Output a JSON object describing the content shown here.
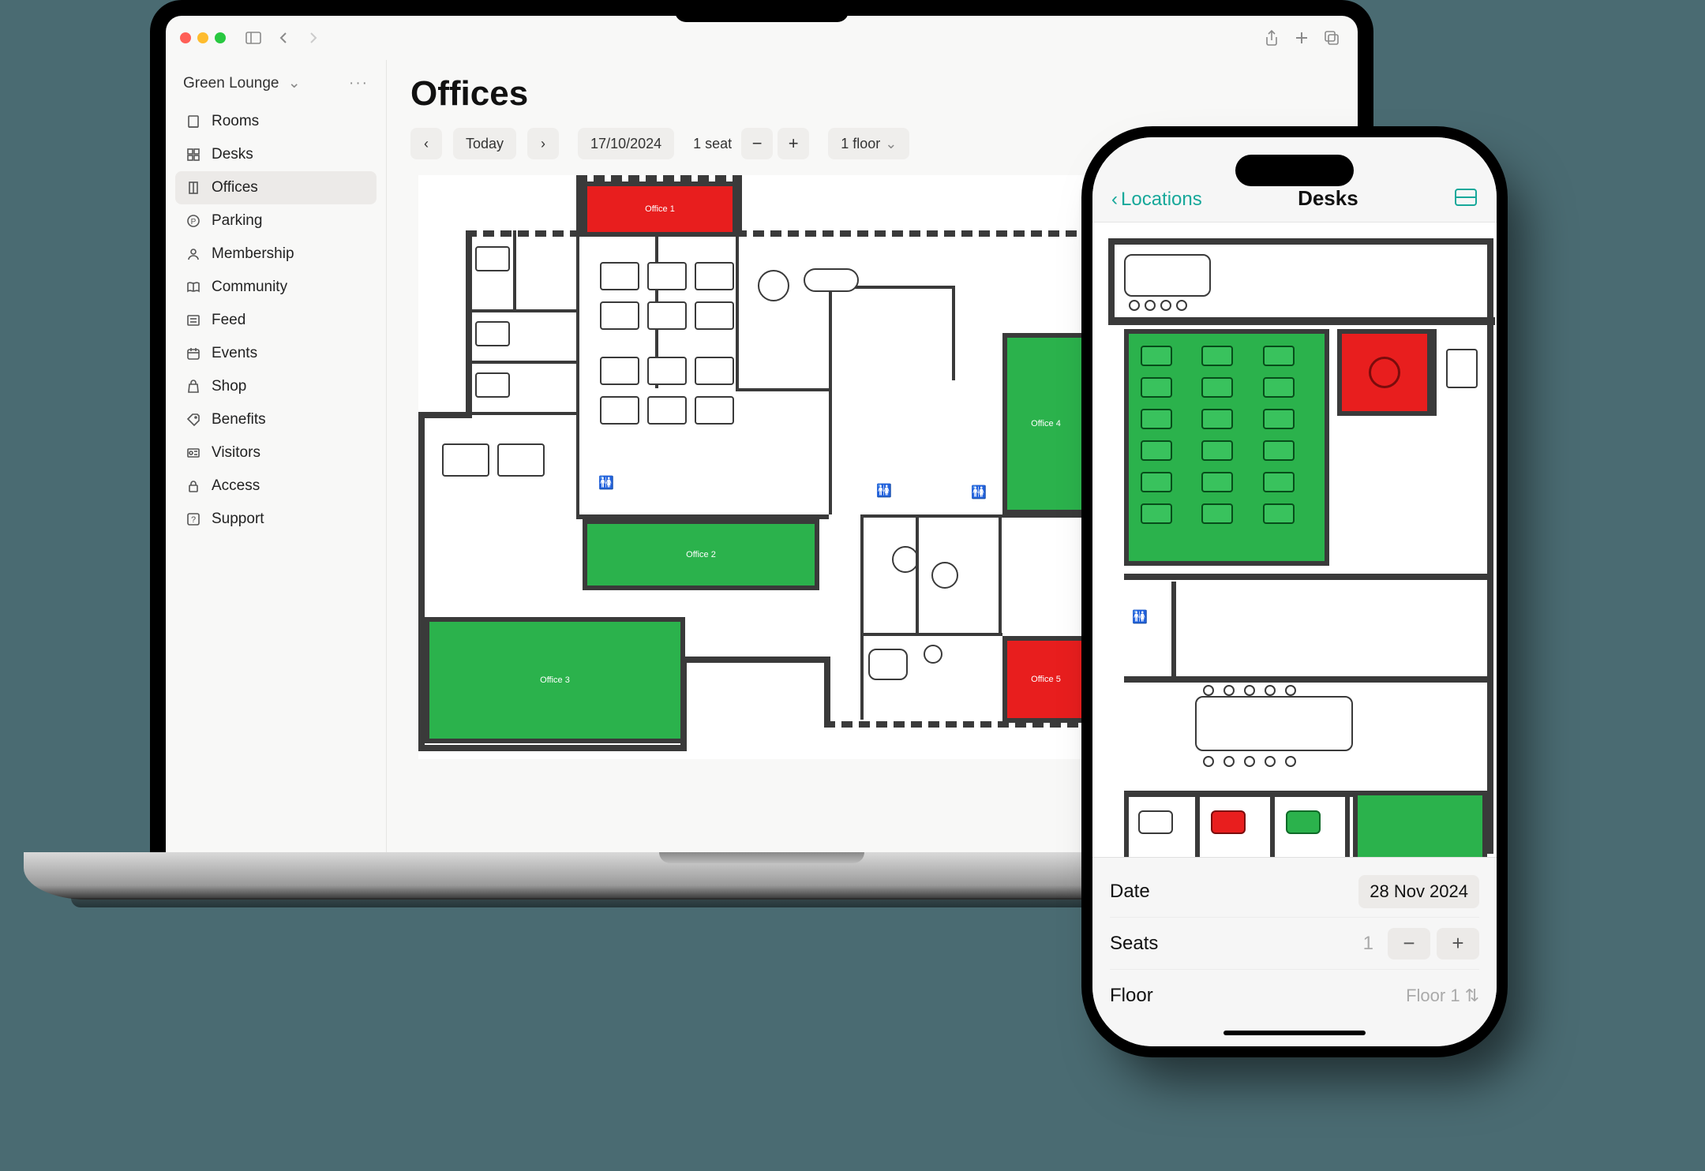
{
  "desktop": {
    "location": "Green Lounge",
    "page_title": "Offices",
    "toolbar": {
      "today": "Today",
      "date": "17/10/2024",
      "seats_label": "1 seat",
      "minus": "−",
      "plus": "+",
      "floor_label": "1 floor"
    },
    "sidebar": [
      {
        "icon": "door-icon",
        "label": "Rooms"
      },
      {
        "icon": "grid-icon",
        "label": "Desks"
      },
      {
        "icon": "office-icon",
        "label": "Offices",
        "active": true
      },
      {
        "icon": "parking-icon",
        "label": "Parking"
      },
      {
        "icon": "person-icon",
        "label": "Membership"
      },
      {
        "icon": "book-icon",
        "label": "Community"
      },
      {
        "icon": "feed-icon",
        "label": "Feed"
      },
      {
        "icon": "calendar-icon",
        "label": "Events"
      },
      {
        "icon": "bag-icon",
        "label": "Shop"
      },
      {
        "icon": "tag-icon",
        "label": "Benefits"
      },
      {
        "icon": "id-icon",
        "label": "Visitors"
      },
      {
        "icon": "lock-icon",
        "label": "Access"
      },
      {
        "icon": "help-icon",
        "label": "Support"
      }
    ],
    "offices": {
      "o1": "Office 1",
      "o2": "Office 2",
      "o3": "Office 3",
      "o4": "Office 4",
      "o5": "Office 5"
    },
    "colors": {
      "available": "#2bb24c",
      "busy": "#e81e1e",
      "wall": "#3a3a3a"
    }
  },
  "phone": {
    "back_label": "Locations",
    "title": "Desks",
    "rows": {
      "date_label": "Date",
      "date_value": "28 Nov 2024",
      "seats_label": "Seats",
      "seats_value": "1",
      "floor_label": "Floor",
      "floor_value": "Floor 1"
    }
  }
}
